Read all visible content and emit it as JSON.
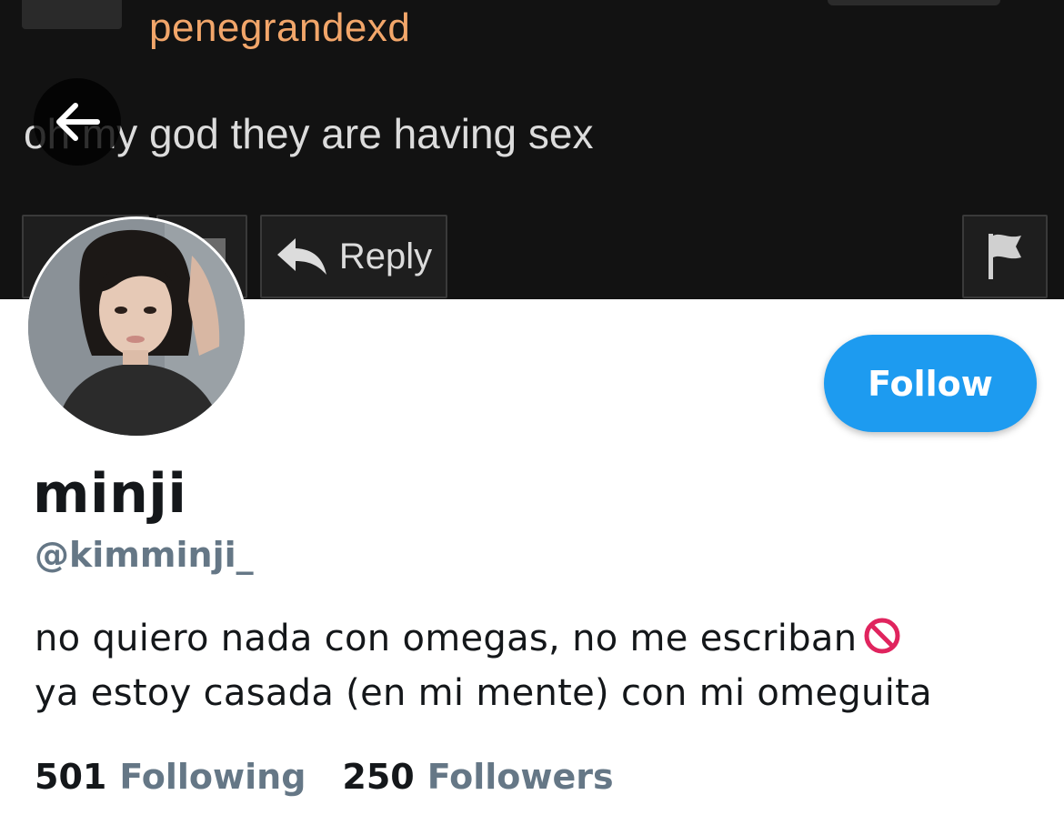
{
  "banner": {
    "username": "penegrandexd",
    "comment": "oh my god they are having sex",
    "reply_label": "Reply"
  },
  "profile": {
    "display_name": "minji",
    "handle": "@kimminji_",
    "bio_lines": [
      "no quiero nada con omegas, no me escriban",
      "ya estoy casada (en mi mente) con mi omeguita"
    ],
    "follow_label": "Follow",
    "following_count": "501",
    "following_label": "Following",
    "followers_count": "250",
    "followers_label": "Followers"
  },
  "colors": {
    "accent": "#1d9bf0",
    "text_primary": "#14171a",
    "text_secondary": "#657786",
    "banner_bg": "#121212",
    "banner_username": "#f2a66a"
  },
  "icons": {
    "back": "arrow-left-icon",
    "reply": "reply-arrow-icon",
    "flag": "flag-icon",
    "bio_emoji": "no-entry-icon"
  }
}
